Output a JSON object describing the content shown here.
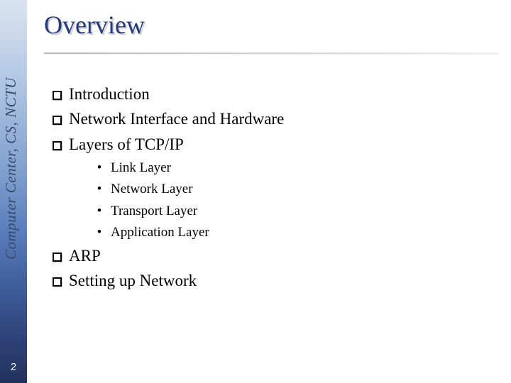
{
  "sidebar": {
    "label": "Computer Center, CS, NCTU",
    "page_number": "2"
  },
  "title": "Overview",
  "bullets": [
    {
      "label": "Introduction"
    },
    {
      "label": "Network Interface and Hardware"
    },
    {
      "label": "Layers of TCP/IP",
      "sub": [
        {
          "label": "Link Layer"
        },
        {
          "label": "Network Layer"
        },
        {
          "label": "Transport Layer"
        },
        {
          "label": "Application Layer"
        }
      ]
    },
    {
      "label": "ARP"
    },
    {
      "label": "Setting up Network"
    }
  ]
}
